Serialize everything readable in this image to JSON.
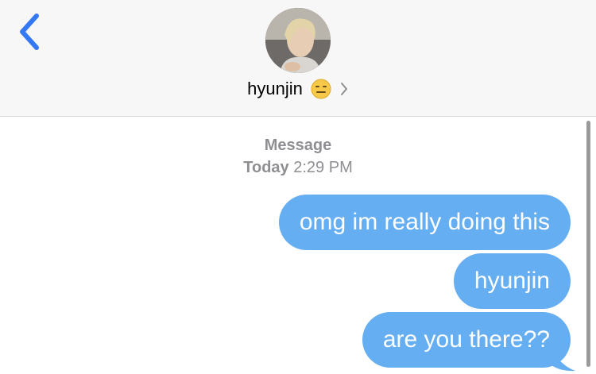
{
  "header": {
    "contact_name": "hyunjin",
    "back_icon": "chevron-left-icon",
    "status_emoji": "expressionless-face-emoji",
    "details_icon": "chevron-right-icon"
  },
  "thread": {
    "service_label": "Message",
    "day_label": "Today",
    "time_label": "2:29 PM",
    "messages": [
      {
        "text": "omg im really doing this",
        "sender": "me"
      },
      {
        "text": "hyunjin",
        "sender": "me"
      },
      {
        "text": "are you there??",
        "sender": "me"
      }
    ]
  },
  "colors": {
    "bubble": "#66aef2",
    "accent": "#3478f6",
    "meta_text": "#8e8e93"
  }
}
